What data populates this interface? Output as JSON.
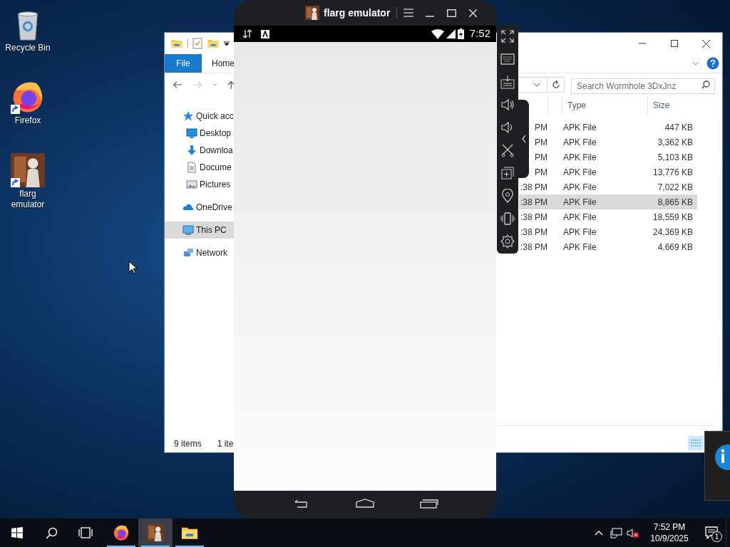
{
  "desktop_icons": [
    {
      "kind": "recycle",
      "label": "Recycle Bin"
    },
    {
      "kind": "firefox",
      "label": "Firefox"
    },
    {
      "kind": "flarg",
      "label": "flarg emulator"
    }
  ],
  "explorer": {
    "ribbon_tabs": [
      {
        "kind": "file",
        "label": "File"
      },
      {
        "kind": "tab",
        "label": "Home"
      }
    ],
    "nav_tree": [
      {
        "kind": "star",
        "label": "Quick acc",
        "selected": false,
        "children": [
          {
            "kind": "desktop",
            "label": "Desktop",
            "selected": false
          },
          {
            "kind": "download",
            "label": "Downloa",
            "selected": false
          },
          {
            "kind": "document",
            "label": "Docume",
            "selected": false
          },
          {
            "kind": "pictures",
            "label": "Pictures",
            "selected": false
          }
        ]
      },
      {
        "kind": "cloud",
        "label": "OneDrive",
        "selected": false
      },
      {
        "kind": "pc",
        "label": "This PC",
        "selected": true
      },
      {
        "kind": "network",
        "label": "Network",
        "selected": false
      }
    ],
    "search": {
      "placeholder": "Search Wormhole 3DxJnz"
    },
    "columns": [
      "Type",
      "Size"
    ],
    "rows": [
      {
        "modified": "PM",
        "type": "APK File",
        "size": "447 KB",
        "selected": false
      },
      {
        "modified": "PM",
        "type": "APK File",
        "size": "3,362 KB",
        "selected": false
      },
      {
        "modified": "PM",
        "type": "APK File",
        "size": "5,103 KB",
        "selected": false
      },
      {
        "modified": "PM",
        "type": "APK File",
        "size": "13,776 KB",
        "selected": false
      },
      {
        "modified": ":38 PM",
        "type": "APK File",
        "size": "7,022 KB",
        "selected": false
      },
      {
        "modified": ":38 PM",
        "type": "APK File",
        "size": "8,865 KB",
        "selected": true
      },
      {
        "modified": ":38 PM",
        "type": "APK File",
        "size": "18,559 KB",
        "selected": false
      },
      {
        "modified": ":38 PM",
        "type": "APK File",
        "size": "24,369 KB",
        "selected": false
      },
      {
        "modified": ":38 PM",
        "type": "APK File",
        "size": "4,669 KB",
        "selected": false
      }
    ],
    "status": [
      "9 items",
      "1 ite"
    ]
  },
  "emulator": {
    "title": "flarg emulator",
    "clock": "7:52"
  },
  "taskbar": {
    "apps": [
      {
        "kind": "firefox",
        "running": true,
        "selected": false
      },
      {
        "kind": "flarg",
        "running": true,
        "selected": true
      },
      {
        "kind": "explorer",
        "running": true,
        "selected": false
      }
    ],
    "time": "7:52 PM",
    "date": "10/9/2025",
    "notification_count": "1"
  }
}
